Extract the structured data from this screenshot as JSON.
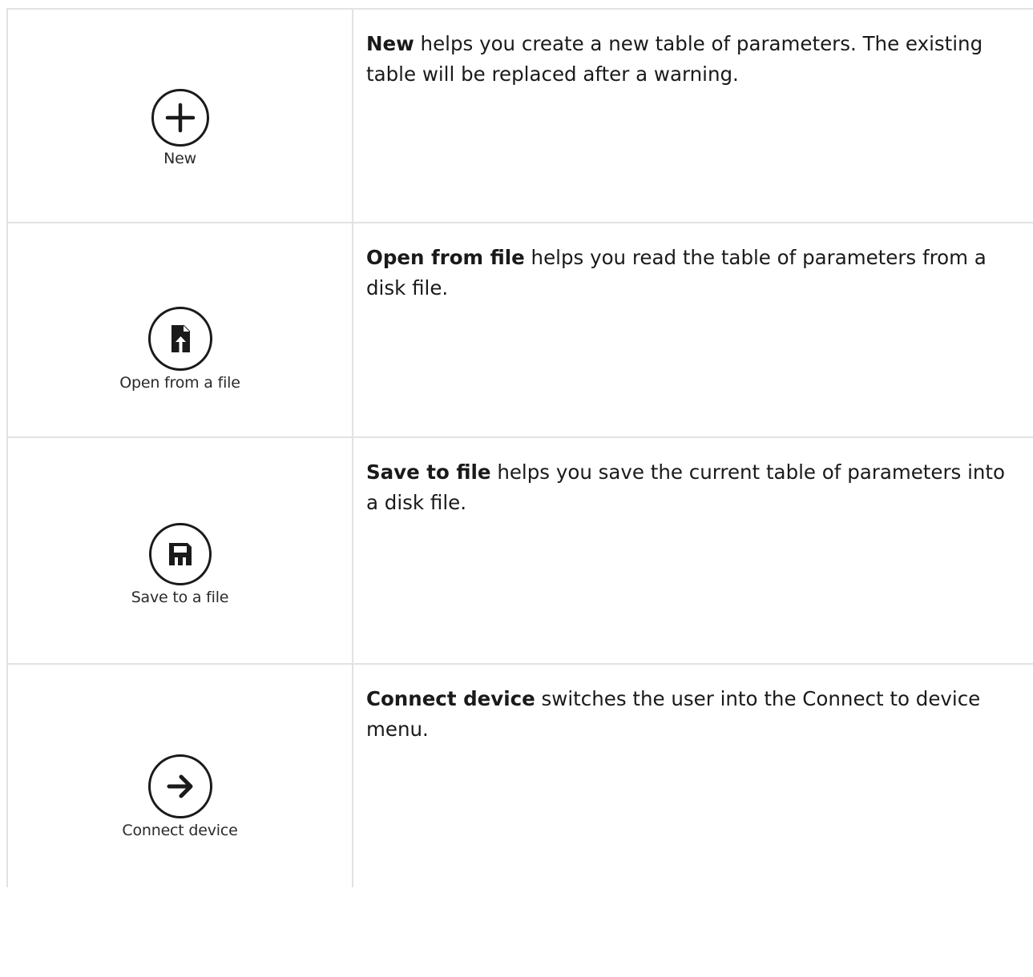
{
  "rows": [
    {
      "icon": "plus-icon",
      "button_label": "New",
      "term": "New",
      "description": " helps you create a new table of parameters. The existing table will be replaced after a warning."
    },
    {
      "icon": "file-upload-icon",
      "button_label": "Open from a file",
      "term": "Open from file",
      "description": " helps you read the table of parameters from a disk file."
    },
    {
      "icon": "floppy-disk-icon",
      "button_label": "Save to a file",
      "term": "Save to file",
      "description": " helps you save the current table of parameters into a disk file."
    },
    {
      "icon": "arrow-right-icon",
      "button_label": "Connect device",
      "term": "Connect device",
      "description": " switches the user into the Connect to device menu."
    }
  ],
  "colors": {
    "border": "#e2e2e2",
    "icon": "#1a1a1a",
    "text": "#1a1a1a"
  }
}
